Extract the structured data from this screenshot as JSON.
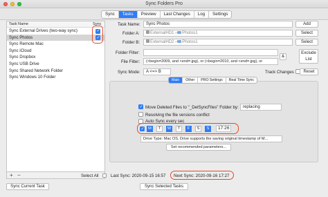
{
  "window": {
    "title": "Sync Folders Pro"
  },
  "tabs": [
    "Sync",
    "Tasks",
    "Preview",
    "Last Changes",
    "Log",
    "Settings"
  ],
  "sidebar": {
    "header_name": "Task Name",
    "header_sync": "Sync",
    "items": [
      {
        "label": "Sync External Drives (two-way sync)",
        "checked": true
      },
      {
        "label": "Sync Photos",
        "checked": true,
        "selected": true
      },
      {
        "label": "Sync Remote Mac",
        "checked": false
      },
      {
        "label": "Sync iCloud",
        "checked": false
      },
      {
        "label": "Sync Dropbox",
        "checked": false
      },
      {
        "label": "Sync USB Drive",
        "checked": false
      },
      {
        "label": "Sync Shared Network Folder",
        "checked": false
      },
      {
        "label": "Sync Windows 10 Folder",
        "checked": false
      }
    ],
    "add_icon": "+",
    "remove_icon": "−",
    "select_all_label": "Select All"
  },
  "form": {
    "task_name_label": "Task Name:",
    "task_name_value": "Sync Photos",
    "add_label": "Add",
    "folder_a_label": "Folder A:",
    "folder_a_drive": "ExternalHD1",
    "folder_a_folder": "Photos1",
    "folder_b_label": "Folder B:",
    "folder_b_drive": "ExternalHD2",
    "folder_b_folder": "Photos1",
    "select_label": "Select",
    "folder_filter_label": "Folder Filter:",
    "file_filter_label": "File Filter:",
    "file_filter_value": "(<begin=2009, and <end=.jpg), or (<begin=2010, and <end=.jpg), or",
    "and_symbol": "&",
    "exclude_list_line1": "Exclude",
    "exclude_list_line2": "List",
    "sync_mode_label": "Sync Mode:",
    "sync_mode_value": "A <=> B",
    "track_changes_label": "Track Changes",
    "reset_label": "Reset"
  },
  "subtabs": [
    "Main",
    "Other",
    "PRO Settings",
    "Real Time Sync"
  ],
  "options": {
    "move_deleted_label": "Move Deleted Files to \"_DelSyncFiles\" Folder by:",
    "replacing_value": "replacing",
    "resolve_conflict_label": "Resolving the file versions conflict",
    "auto_sync_label": "Auto Sync every sec",
    "days": [
      "M",
      "T",
      "W",
      "T",
      "F",
      "S",
      "S"
    ],
    "schedule_time": "17:26",
    "drive_type_value": "Drive Type: Mac OS. Drive supports the saving original timestamp of M...",
    "set_recommended_label": "Set recommended parameters..."
  },
  "status": {
    "last_sync": "Last Sync: 2020-09-15 16:57",
    "next_sync": "Next Sync: 2020-09-16 17:27"
  },
  "footer": {
    "sync_current_label": "Sync Current Task",
    "sync_selected_label": "Sync Selected Tasks"
  },
  "colors": {
    "accent": "#2f7cf6",
    "highlight_ring": "#e34a2a"
  }
}
